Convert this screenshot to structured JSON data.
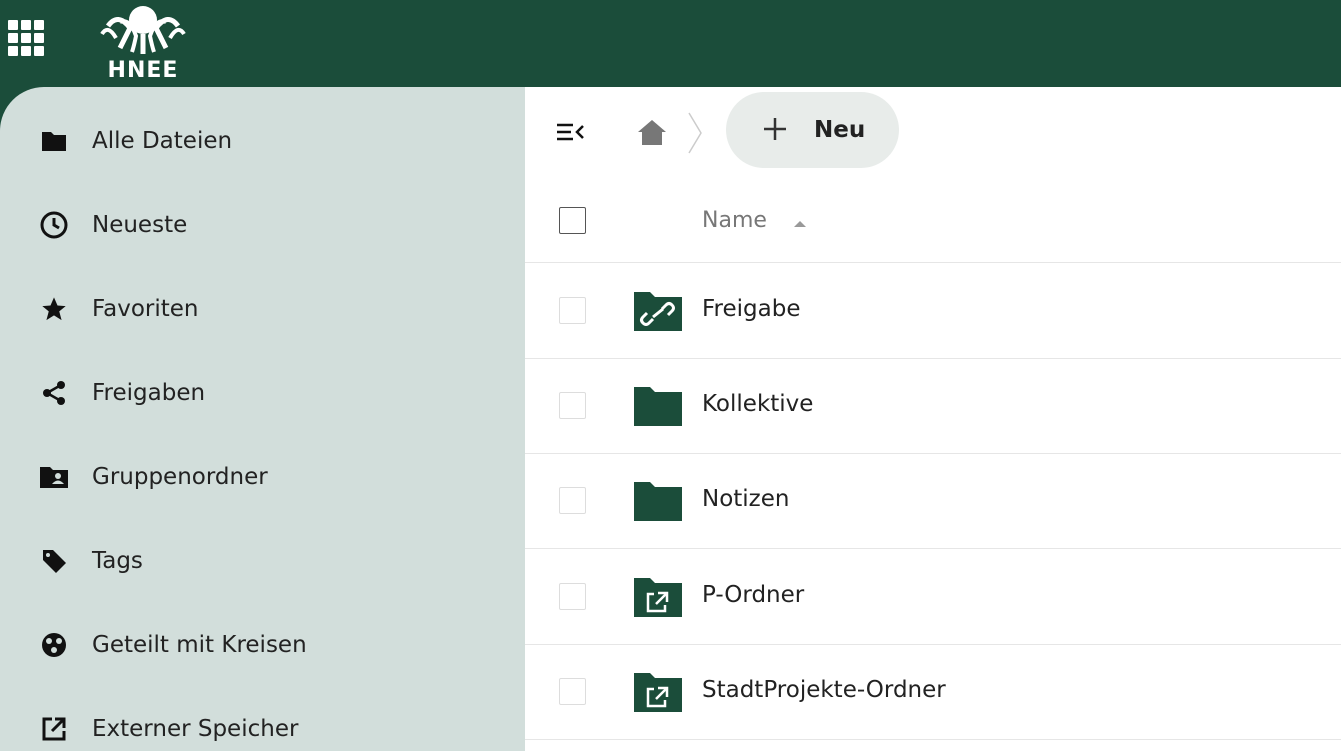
{
  "header": {
    "logo_text": "HNEE",
    "apps_icon": "apps-grid-icon",
    "brand_color": "#1b4d3a"
  },
  "sidebar": {
    "background_color": "#d2dedb",
    "items": [
      {
        "label": "Alle Dateien",
        "icon": "folder-icon"
      },
      {
        "label": "Neueste",
        "icon": "clock-icon"
      },
      {
        "label": "Favoriten",
        "icon": "star-icon"
      },
      {
        "label": "Freigaben",
        "icon": "share-icon"
      },
      {
        "label": "Gruppenordner",
        "icon": "group-folder-icon"
      },
      {
        "label": "Tags",
        "icon": "tag-icon"
      },
      {
        "label": "Geteilt mit Kreisen",
        "icon": "circles-icon"
      },
      {
        "label": "Externer Speicher",
        "icon": "external-storage-icon"
      }
    ]
  },
  "toolbar": {
    "new_label": "Neu",
    "toggle_icon": "sidebar-toggle-icon",
    "home_icon": "home-icon"
  },
  "table": {
    "name_header": "Name",
    "sort_icon": "sort-ascending-icon",
    "folder_color": "#1b4d3a",
    "rows": [
      {
        "name": "Freigabe",
        "icon": "shared-link-folder-icon"
      },
      {
        "name": "Kollektive",
        "icon": "folder-icon"
      },
      {
        "name": "Notizen",
        "icon": "folder-icon"
      },
      {
        "name": "P-Ordner",
        "icon": "external-folder-icon"
      },
      {
        "name": "StadtProjekte-Ordner",
        "icon": "external-folder-icon"
      }
    ]
  }
}
